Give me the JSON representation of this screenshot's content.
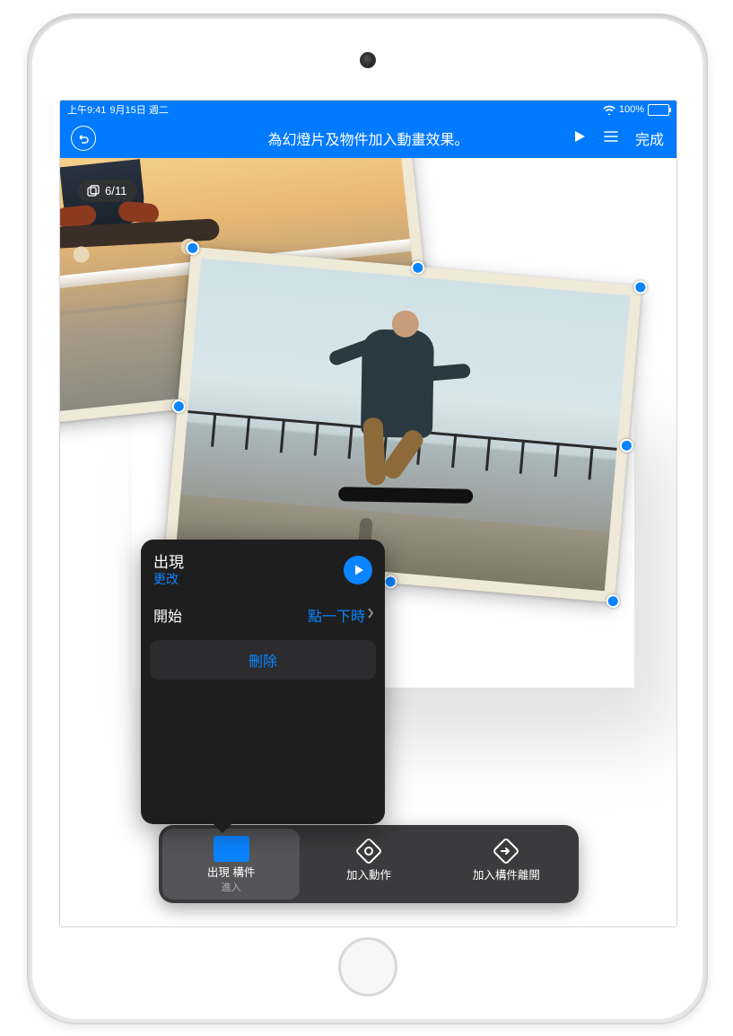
{
  "status": {
    "time": "上午9:41",
    "date": "9月15日 週二",
    "battery_text": "100%"
  },
  "nav": {
    "title": "為幻燈片及物件加入動畫效果。",
    "done": "完成"
  },
  "slide_counter": {
    "text": "6/11"
  },
  "popover": {
    "effect_name": "出現",
    "change": "更改",
    "start_label": "開始",
    "start_value": "點一下時",
    "delete": "刪除"
  },
  "toolbar": {
    "item1_label": "出現 構件",
    "item1_sub": "進入",
    "item2_label": "加入動作",
    "item3_label": "加入構件離開"
  }
}
